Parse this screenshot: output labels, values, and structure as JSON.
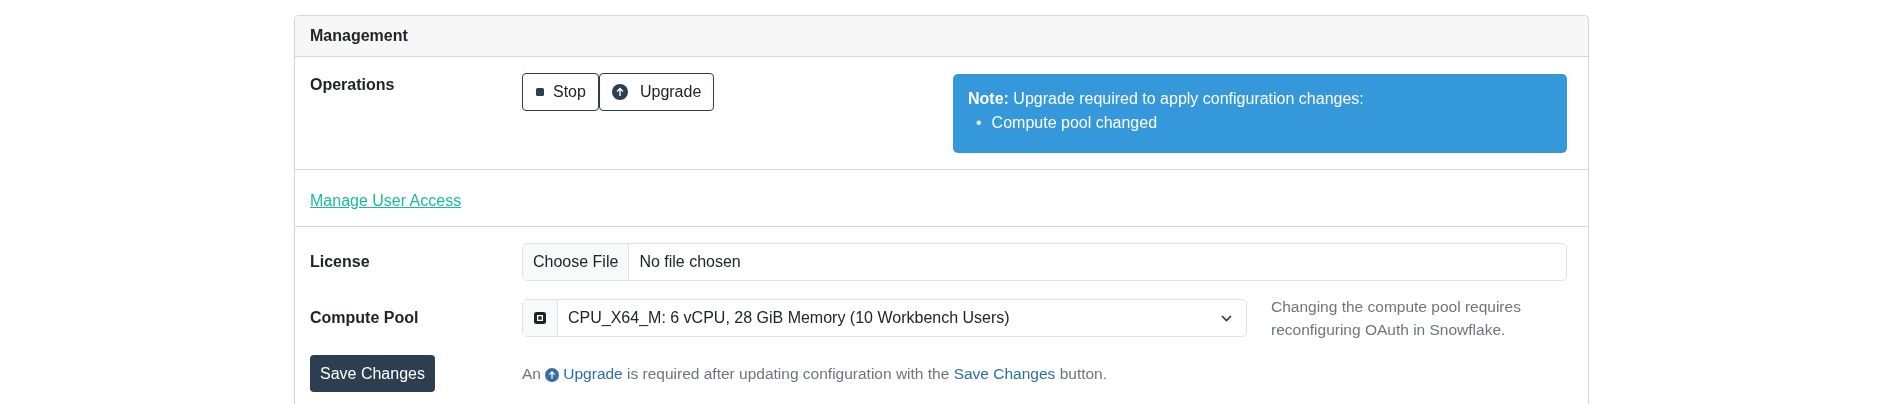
{
  "card": {
    "title": "Management"
  },
  "operations": {
    "label": "Operations",
    "buttons": [
      {
        "kind": "stop",
        "label": "Stop"
      },
      {
        "kind": "upgrade",
        "label": "Upgrade"
      }
    ],
    "note": {
      "text": "**Note:** Upgrade required to apply configuration changes:",
      "items": [
        {
          "bullet": "•",
          "text": "Compute pool changed"
        }
      ]
    }
  },
  "access_link": "Manage User Access",
  "license": {
    "label": "License",
    "button": "Choose File",
    "value": "No file chosen"
  },
  "compute_pool": {
    "label": "Compute Pool",
    "value": "CPU_X64_M: 6 vCPU, 28 GiB Memory (10 Workbench Users)",
    "help": "Changing the compute pool requires reconfiguring OAuth in Snowflake."
  },
  "save": {
    "button": "Save Changes",
    "hint": [
      {
        "kind": "text",
        "text": "An"
      },
      {
        "kind": "upgrade_link",
        "text": "Upgrade"
      },
      {
        "kind": "text",
        "text": "is required after updating configuration with the"
      },
      {
        "kind": "link",
        "text": "Save Changes"
      },
      {
        "kind": "text",
        "text": "button."
      }
    ]
  }
}
